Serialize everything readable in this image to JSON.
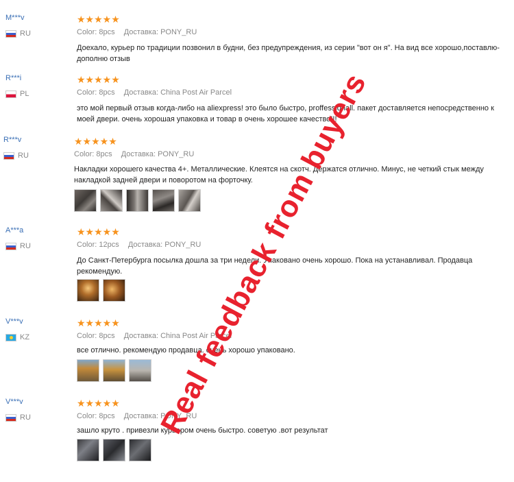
{
  "star_glyphs": "★★★★★",
  "labels": {
    "color": "Color:",
    "delivery": "Доставка:"
  },
  "reviews": [
    {
      "user": "M***v",
      "country": "RU",
      "flag": "flag-ru",
      "color": "8pcs",
      "delivery": "PONY_RU",
      "text": "Доехало, курьер по традиции позвонил в будни, без предупреждения, из серии \"вот он я\". На вид все хорошо,поставлю-дополню отзыв",
      "thumbs": []
    },
    {
      "user": "R***i",
      "country": "PL",
      "flag": "flag-pl",
      "color": "8pcs",
      "delivery": "China Post Air Parcel",
      "text": "это мой первый отзыв когда-либо на aliexpress! это было быстро, proffessionall. пакет доставляется непосредственно к моей двери. очень хорошая упаковка и товар в очень хорошее качество!!!",
      "thumbs": []
    },
    {
      "user": "R***v",
      "country": "RU",
      "flag": "flag-ru",
      "color": "8pcs",
      "delivery": "PONY_RU",
      "text": "Накладки хорошего качества 4+. Металлические. Клеятся на скотч. Держатся отлично. Минус, не четкий стык между накладкой задней двери и поворотом на форточку.",
      "thumbs": [
        "t-car1",
        "t-car2",
        "t-car3",
        "t-car4",
        "t-car5"
      ]
    },
    {
      "user": "A***a",
      "country": "RU",
      "flag": "flag-ru",
      "color": "12pcs",
      "delivery": "PONY_RU",
      "text": "До Санкт-Петербурга посылка дошла за три недели. Упаковано очень хорошо. Пока на устанавливал. Продавца рекомендую.",
      "thumbs": [
        "t-warm1",
        "t-warm2"
      ]
    },
    {
      "user": "V***v",
      "country": "KZ",
      "flag": "flag-kz",
      "color": "8pcs",
      "delivery": "China Post Air Parcel",
      "text": "все отлично. рекомендую продавца. очень хорошо упаковано.",
      "thumbs": [
        "t-box1",
        "t-box2",
        "t-box3"
      ]
    },
    {
      "user": "V***v",
      "country": "RU",
      "flag": "flag-ru",
      "color": "8pcs",
      "delivery": "PONY_RU",
      "text": "зашло круто . привезли курьером очень быстро. советую .вот результат",
      "thumbs": [
        "t-dark1",
        "t-dark2",
        "t-dark3"
      ]
    }
  ],
  "watermark": "Real  feedback  from  buyers",
  "colors": {
    "username": "#3a6fb5",
    "stars": "#f7931e",
    "watermark": "#e8222e"
  }
}
